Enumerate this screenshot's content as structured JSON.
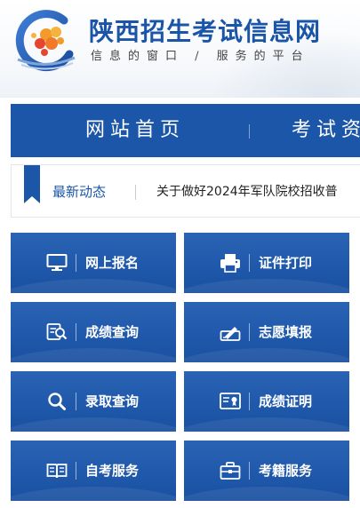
{
  "header": {
    "site_title": "陕西招生考试信息网",
    "slogan": "信息的窗口 / 服务的平台"
  },
  "nav": {
    "items": [
      {
        "label": "网站首页"
      },
      {
        "label": "考试资"
      }
    ]
  },
  "news": {
    "label": "最新动态",
    "headline": "关于做好2024年军队院校招收普"
  },
  "services": [
    {
      "label": "网上报名",
      "icon": "monitor-icon"
    },
    {
      "label": "证件打印",
      "icon": "printer-icon"
    },
    {
      "label": "成绩查询",
      "icon": "score-search-icon"
    },
    {
      "label": "志愿填报",
      "icon": "edit-form-icon"
    },
    {
      "label": "录取查询",
      "icon": "search-icon"
    },
    {
      "label": "成绩证明",
      "icon": "certificate-icon"
    },
    {
      "label": "自考服务",
      "icon": "book-icon"
    },
    {
      "label": "考籍服务",
      "icon": "briefcase-icon"
    }
  ],
  "colors": {
    "primary": "#1c56a8",
    "tile": "#1f58aa",
    "logo_orange": "#f39a2b",
    "logo_red": "#e6462e"
  }
}
